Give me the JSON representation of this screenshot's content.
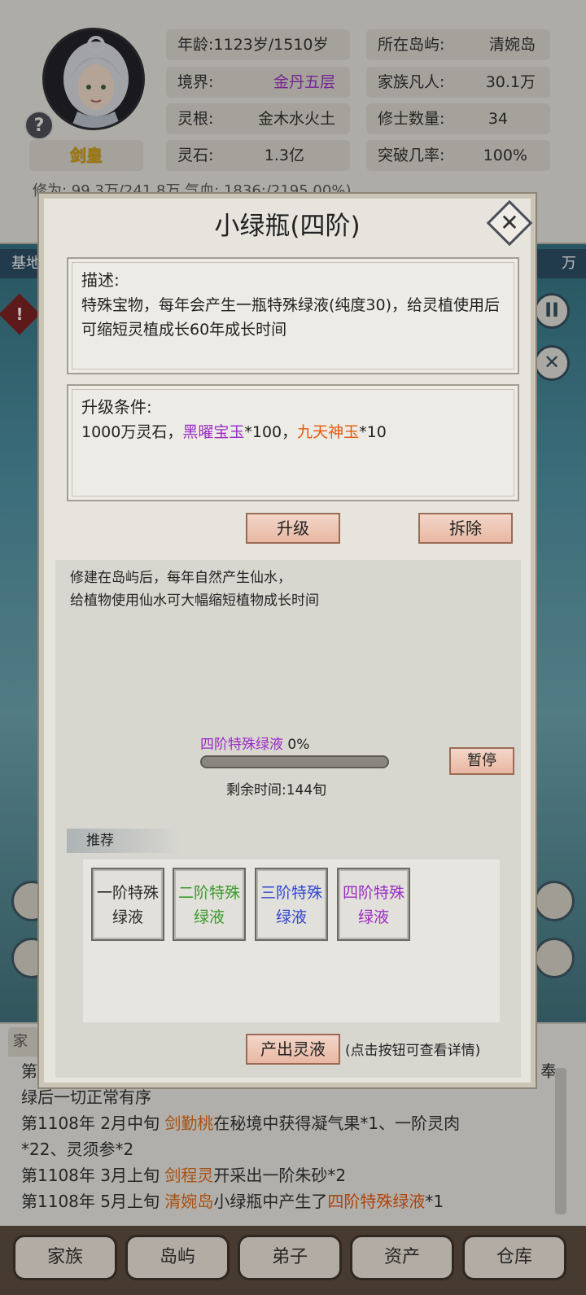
{
  "character": {
    "title": "剑皇",
    "help": "?",
    "stats_left": [
      {
        "label": "年龄:",
        "value": "1123岁/1510岁"
      },
      {
        "label": "境界:",
        "value": "金丹五层"
      },
      {
        "label": "灵根:",
        "value": "金木水火土"
      },
      {
        "label": "灵石:",
        "value": "1.3亿"
      }
    ],
    "stats_right": [
      {
        "label": "所在岛屿:",
        "value": "清婉岛"
      },
      {
        "label": "家族凡人:",
        "value": "30.1万"
      },
      {
        "label": "修士数量:",
        "value": "34"
      },
      {
        "label": "突破几率:",
        "value": "100%"
      }
    ],
    "partial_row": "修为:    99.3万/241.8万                气血:  1836:/2195  00%)"
  },
  "map": {
    "tab_left": "基地",
    "tab_right": "万",
    "warn_glyph": "!",
    "pause_glyph": "II",
    "close_glyph": "✕"
  },
  "modal": {
    "title": "小绿瓶(四阶)",
    "close_glyph": "✕",
    "description_head": "描述:",
    "description_body": "特殊宝物，每年会产生一瓶特殊绿液(纯度30)，给灵植使用后可缩短灵植成长60年成长时间",
    "upgrade_head": "升级条件:",
    "upgrade_parts": [
      {
        "text": "1000万灵石，",
        "color": "#222222"
      },
      {
        "text": "黑曜宝玉",
        "color": "#9b2cc4"
      },
      {
        "text": "*100，",
        "color": "#222222"
      },
      {
        "text": "九天神玉",
        "color": "#e8590c"
      },
      {
        "text": "*10",
        "color": "#222222"
      }
    ],
    "upgrade_button": "升级",
    "dismantle_button": "拆除",
    "building_desc_line1": "修建在岛屿后，每年自然产生仙水，",
    "building_desc_line2": "给植物使用仙水可大幅缩短植物成长时间",
    "production_item": "四阶特殊绿液",
    "production_percent": "0%",
    "production_progress": 0,
    "pause_button": "暂停",
    "remaining_time": "剩余时间:144旬",
    "recommend_label": "推荐",
    "recommend_items": [
      {
        "line1": "一阶特殊",
        "line2": "绿液",
        "color": "#222222"
      },
      {
        "line1": "二阶特殊",
        "line2": "绿液",
        "color": "#3b9a2c"
      },
      {
        "line1": "三阶特殊",
        "line2": "绿液",
        "color": "#3247d1"
      },
      {
        "line1": "四阶特殊",
        "line2": "绿液",
        "color": "#9b2cc4"
      }
    ],
    "output_button": "产出灵液",
    "output_hint": "(点击按钮可查看详情)"
  },
  "log": {
    "tab": "家",
    "lines": [
      {
        "parts": [
          {
            "t": "第",
            "c": ""
          }
        ]
      },
      {
        "parts": [
          {
            "t": "       绿后一切正常有序",
            "c": ""
          }
        ]
      },
      {
        "parts": [
          {
            "t": "第1108年  2月中旬  ",
            "c": ""
          },
          {
            "t": "剑勤桃",
            "c": "person"
          },
          {
            "t": "在秘境中获得凝气果*1、一阶灵肉",
            "c": ""
          }
        ]
      },
      {
        "parts": [
          {
            "t": "       *22、灵须参*2",
            "c": ""
          }
        ]
      },
      {
        "parts": [
          {
            "t": "第1108年  3月上旬  ",
            "c": ""
          },
          {
            "t": "剑程灵",
            "c": "person"
          },
          {
            "t": "开采出一阶朱砂*2",
            "c": ""
          }
        ]
      },
      {
        "parts": [
          {
            "t": "第1108年  5月上旬  ",
            "c": ""
          },
          {
            "t": "清婉岛",
            "c": "person"
          },
          {
            "t": "小绿瓶中产生了",
            "c": ""
          },
          {
            "t": "四阶特殊绿液",
            "c": "product"
          },
          {
            "t": "*1",
            "c": ""
          }
        ]
      }
    ],
    "right_fragment": "奉"
  },
  "nav": [
    "家族",
    "岛屿",
    "弟子",
    "资产",
    "仓库"
  ]
}
